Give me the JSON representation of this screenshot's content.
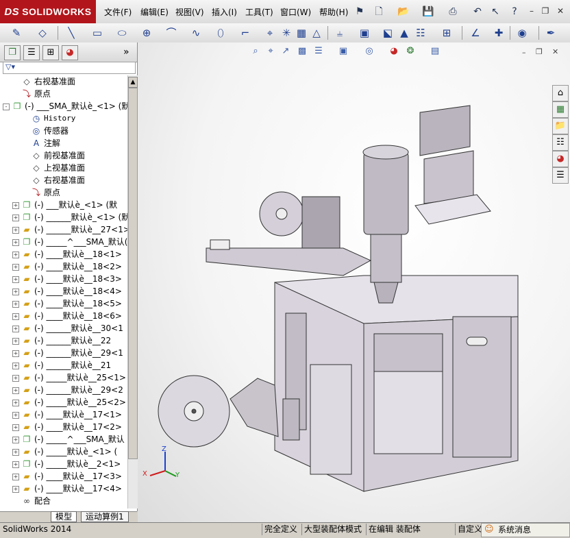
{
  "app": {
    "logo_ds": "DS",
    "logo_text": "SOLIDWORKS"
  },
  "menu": [
    "文件(F)",
    "编辑(E)",
    "视图(V)",
    "插入(I)",
    "工具(T)",
    "窗口(W)",
    "帮助(H)"
  ],
  "panel_tabs": [
    "feature-manager",
    "property-manager",
    "configuration-manager",
    "appearance"
  ],
  "tree": [
    {
      "label": "右视基准面",
      "icon": "plane-icon",
      "indent": 1,
      "exp": ""
    },
    {
      "label": "原点",
      "icon": "origin-icon",
      "indent": 1,
      "exp": ""
    },
    {
      "label": "(-) ___SMA_默认è_<1> (默",
      "icon": "assembly-icon",
      "indent": 0,
      "exp": "-"
    },
    {
      "label": "History",
      "icon": "history-icon",
      "indent": 2,
      "exp": "",
      "mono": true
    },
    {
      "label": "传感器",
      "icon": "sensor-icon",
      "indent": 2,
      "exp": ""
    },
    {
      "label": "注解",
      "icon": "annotation-icon",
      "indent": 2,
      "exp": ""
    },
    {
      "label": "前视基准面",
      "icon": "plane-icon",
      "indent": 2,
      "exp": ""
    },
    {
      "label": "上视基准面",
      "icon": "plane-icon",
      "indent": 2,
      "exp": ""
    },
    {
      "label": "右视基准面",
      "icon": "plane-icon",
      "indent": 2,
      "exp": ""
    },
    {
      "label": "原点",
      "icon": "origin-icon",
      "indent": 2,
      "exp": ""
    },
    {
      "label": "(-) ___默认è_<1> (默",
      "icon": "assembly-icon",
      "indent": 1,
      "exp": "+"
    },
    {
      "label": "(-) ______默认è_<1> (默",
      "icon": "assembly-icon",
      "indent": 1,
      "exp": "+"
    },
    {
      "label": "(-) ______默认è__27<1>",
      "icon": "part-icon",
      "indent": 1,
      "exp": "+"
    },
    {
      "label": "(-) _____^___SMA_默认(",
      "icon": "assembly-icon",
      "indent": 1,
      "exp": "+"
    },
    {
      "label": "(-) ____默认è__18<1>",
      "icon": "part-icon",
      "indent": 1,
      "exp": "+"
    },
    {
      "label": "(-) ____默认è__18<2>",
      "icon": "part-icon",
      "indent": 1,
      "exp": "+"
    },
    {
      "label": "(-) ____默认è__18<3>",
      "icon": "part-icon",
      "indent": 1,
      "exp": "+"
    },
    {
      "label": "(-) ____默认è__18<4>",
      "icon": "part-icon",
      "indent": 1,
      "exp": "+"
    },
    {
      "label": "(-) ____默认è__18<5>",
      "icon": "part-icon",
      "indent": 1,
      "exp": "+"
    },
    {
      "label": "(-) ____默认è__18<6>",
      "icon": "part-icon",
      "indent": 1,
      "exp": "+"
    },
    {
      "label": "(-) ______默认è__30<1",
      "icon": "part-icon",
      "indent": 1,
      "exp": "+"
    },
    {
      "label": "(-) ______默认è__22",
      "icon": "part-icon",
      "indent": 1,
      "exp": "+"
    },
    {
      "label": "(-) ______默认è__29<1",
      "icon": "part-icon",
      "indent": 1,
      "exp": "+"
    },
    {
      "label": "(-) ______默认è__21",
      "icon": "part-icon",
      "indent": 1,
      "exp": "+"
    },
    {
      "label": "(-) _____默认è__25<1>",
      "icon": "part-icon",
      "indent": 1,
      "exp": "+"
    },
    {
      "label": "(-) ______默认è__29<2",
      "icon": "part-icon",
      "indent": 1,
      "exp": "+"
    },
    {
      "label": "(-) _____默认è__25<2>",
      "icon": "part-icon",
      "indent": 1,
      "exp": "+"
    },
    {
      "label": "(-) ____默认è__17<1>",
      "icon": "part-icon",
      "indent": 1,
      "exp": "+"
    },
    {
      "label": "(-) ____默认è__17<2>",
      "icon": "part-icon",
      "indent": 1,
      "exp": "+"
    },
    {
      "label": "(-) _____^___SMA_默认",
      "icon": "assembly-icon",
      "indent": 1,
      "exp": "+"
    },
    {
      "label": "(-) _____默认è_<1> (",
      "icon": "part-icon",
      "indent": 1,
      "exp": "+"
    },
    {
      "label": "(-) _____默认è__2<1>",
      "icon": "assembly-icon",
      "indent": 1,
      "exp": "+"
    },
    {
      "label": "(-) ____默认è__17<3>",
      "icon": "part-icon",
      "indent": 1,
      "exp": "+"
    },
    {
      "label": "(-) ____默认è__17<4>",
      "icon": "part-icon",
      "indent": 1,
      "exp": "+"
    },
    {
      "label": "配合",
      "icon": "mates-icon",
      "indent": 1,
      "exp": ""
    }
  ],
  "bottom_tabs": [
    "模型",
    "运动算例1"
  ],
  "triad": {
    "z": "Z",
    "x": "X",
    "y": "Y"
  },
  "status": {
    "app_version": "SolidWorks 2014",
    "fully_defined": "完全定义",
    "large_assembly": "大型装配体模式",
    "editing": "在编辑 装配体",
    "custom": "自定义",
    "messages": "系统消息"
  },
  "colors": {
    "logo_bg": "#b2151b",
    "part_yellow": "#e8c13a",
    "assembly_green": "#3a9a3a",
    "model_gray": "#c9c4cc"
  }
}
